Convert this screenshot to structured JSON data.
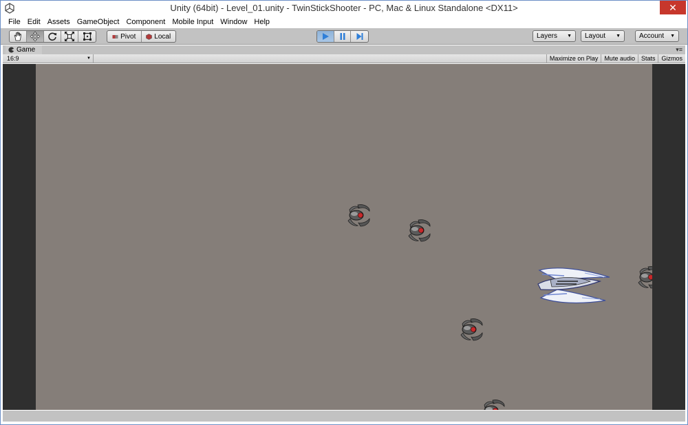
{
  "window": {
    "title": "Unity (64bit) - Level_01.unity - TwinStickShooter - PC, Mac & Linux Standalone <DX11>",
    "close_label": "✕"
  },
  "menu": [
    "File",
    "Edit",
    "Assets",
    "GameObject",
    "Component",
    "Mobile Input",
    "Window",
    "Help"
  ],
  "toolbar": {
    "transform_tools": [
      "hand-icon",
      "move-icon",
      "rotate-icon",
      "scale-icon",
      "rect-icon"
    ],
    "active_tool": "move-icon",
    "pivot_label": "Pivot",
    "local_label": "Local",
    "play_controls": [
      "play-icon",
      "pause-icon",
      "step-icon"
    ],
    "layers_label": "Layers",
    "layout_label": "Layout",
    "account_label": "Account",
    "accent_color": "#2f7fd8"
  },
  "game_tab": {
    "label": "Game",
    "aspect": "16:9",
    "buttons": [
      "Maximize on Play",
      "Mute audio",
      "Stats",
      "Gizmos"
    ]
  },
  "scene": {
    "background_color": "#857e79",
    "letterbox_color": "#2f2f2f"
  }
}
